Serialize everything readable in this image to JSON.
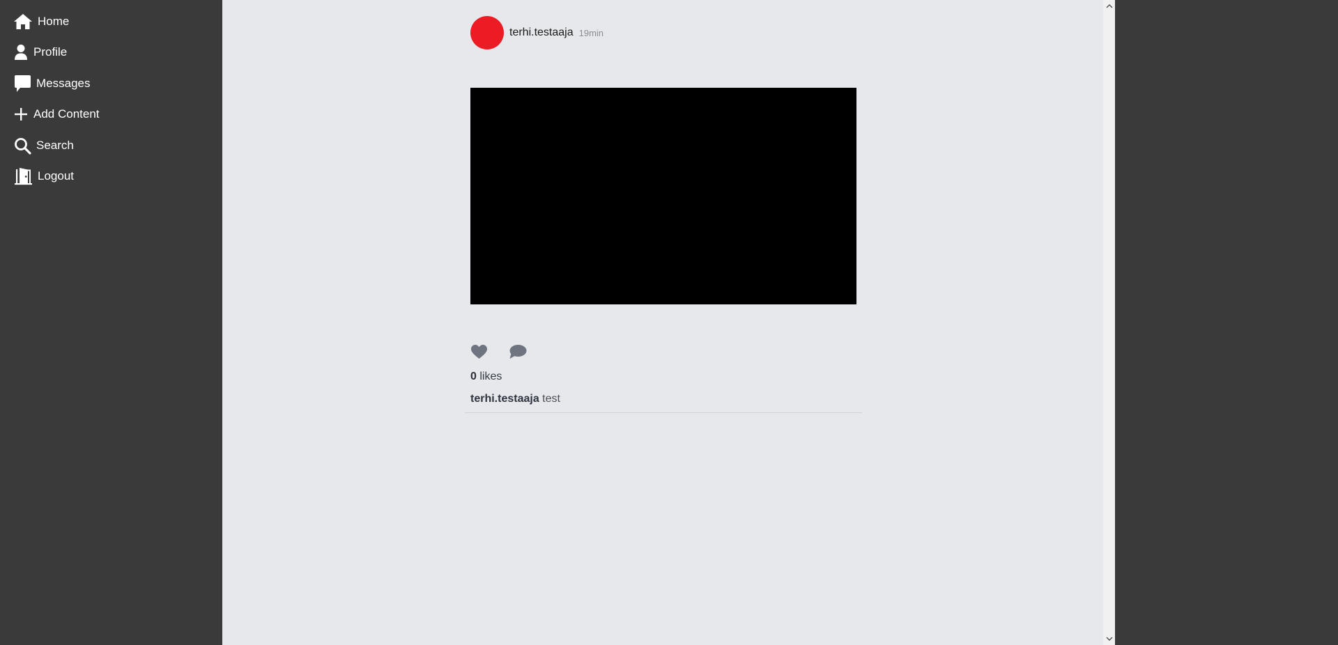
{
  "nav": {
    "items": [
      {
        "label": "Home",
        "icon": "home-icon"
      },
      {
        "label": "Profile",
        "icon": "user-icon"
      },
      {
        "label": "Messages",
        "icon": "message-icon"
      },
      {
        "label": "Add Content",
        "icon": "plus-icon"
      },
      {
        "label": "Search",
        "icon": "search-icon"
      },
      {
        "label": "Logout",
        "icon": "logout-door-icon"
      }
    ]
  },
  "post": {
    "username": "terhi.testaaja",
    "timestamp": "19min",
    "likes_count": "0",
    "likes_label": "likes",
    "caption_user": "terhi.testaaja",
    "caption_text": "test",
    "avatar_color": "#ec1c24"
  },
  "colors": {
    "sidebar_bg": "#3b3a3b",
    "content_bg": "#e7e8eb",
    "icon_gray": "#6e7480"
  }
}
